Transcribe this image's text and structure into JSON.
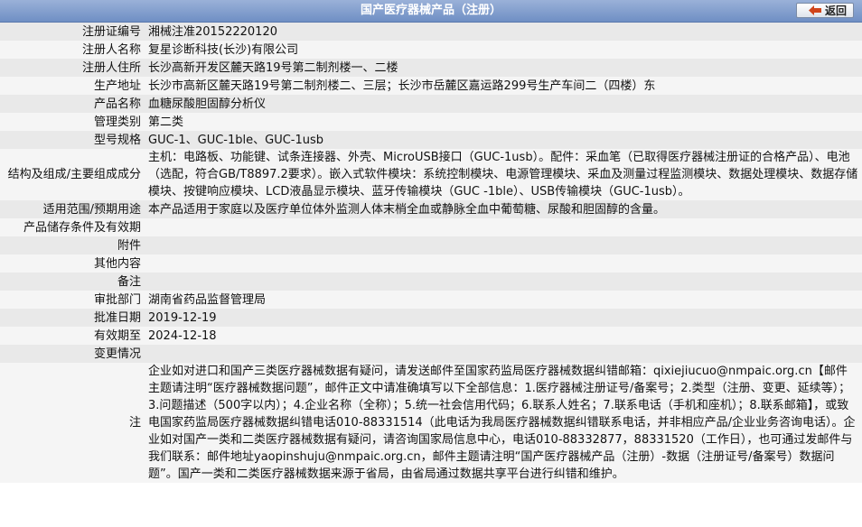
{
  "header": {
    "title": "国产医疗器械产品（注册）",
    "back_label": "返回"
  },
  "rows": [
    {
      "label": "注册证编号",
      "value": "湘械注准20152220120"
    },
    {
      "label": "注册人名称",
      "value": "复星诊断科技(长沙)有限公司"
    },
    {
      "label": "注册人住所",
      "value": "长沙高新开发区麓天路19号第二制剂楼一、二楼"
    },
    {
      "label": "生产地址",
      "value": "长沙市高新区麓天路19号第二制剂楼二、三层；长沙市岳麓区嘉运路299号生产车间二（四楼）东"
    },
    {
      "label": "产品名称",
      "value": "血糖尿酸胆固醇分析仪"
    },
    {
      "label": "管理类别",
      "value": "第二类"
    },
    {
      "label": "型号规格",
      "value": "GUC-1、GUC-1ble、GUC-1usb"
    },
    {
      "label": "结构及组成/主要组成成分",
      "value": "主机：电路板、功能键、试条连接器、外壳、MicroUSB接口（GUC-1usb）。配件：采血笔（已取得医疗器械注册证的合格产品）、电池（选配，符合GB/T8897.2要求）。嵌入式软件模块：系统控制模块、电源管理模块、采血及测量过程监测模块、数据处理模块、数据存储模块、按键响应模块、LCD液晶显示模块、蓝牙传输模块（GUC -1ble）、USB传输模块（GUC-1usb）。"
    },
    {
      "label": "适用范围/预期用途",
      "value": "本产品适用于家庭以及医疗单位体外监测人体末梢全血或静脉全血中葡萄糖、尿酸和胆固醇的含量。"
    },
    {
      "label": "产品储存条件及有效期",
      "value": ""
    },
    {
      "label": "附件",
      "value": ""
    },
    {
      "label": "其他内容",
      "value": ""
    },
    {
      "label": "备注",
      "value": ""
    },
    {
      "label": "审批部门",
      "value": "湖南省药品监督管理局"
    },
    {
      "label": "批准日期",
      "value": "2019-12-19"
    },
    {
      "label": "有效期至",
      "value": "2024-12-18"
    },
    {
      "label": "变更情况",
      "value": ""
    }
  ],
  "note": {
    "label": "注",
    "value": "企业如对进口和国产三类医疗器械数据有疑问，请发送邮件至国家药监局医疗器械数据纠错邮箱：qixiejiucuo@nmpaic.org.cn【邮件主题请注明“医疗器械数据问题”，邮件正文中请准确填写以下全部信息：1.医疗器械注册证号/备案号；2.类型（注册、变更、延续等）；3.问题描述（500字以内）；4.企业名称（全称）；5.统一社会信用代码；6.联系人姓名；7.联系电话（手机和座机）；8.联系邮箱】，或致电国家药监局医疗器械数据纠错电话010-88331514（此电话为我局医疗器械数据纠错联系电话，并非相应产品/企业业务咨询电话）。企业如对国产一类和二类医疗器械数据有疑问，请咨询国家局信息中心，电话010-88332877，88331520（工作日），也可通过发邮件与我们联系：邮件地址yaopinshuju@nmpaic.org.cn，邮件主题请注明“国产医疗器械产品（注册）-数据（注册证号/备案号）数据问题”。国产一类和二类医疗器械数据来源于省局，由省局通过数据共享平台进行纠错和维护。"
  }
}
